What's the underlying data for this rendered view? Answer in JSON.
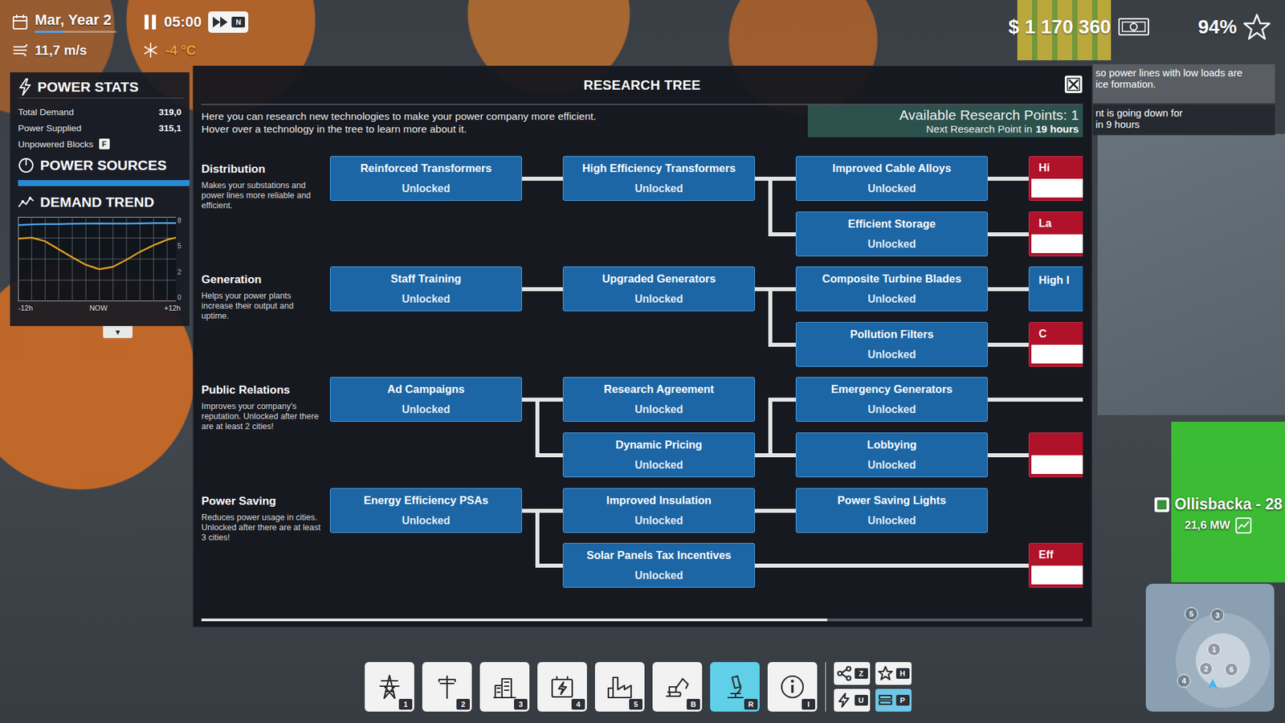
{
  "hud": {
    "date": "Mar, Year 2",
    "date_progress": {
      "level": 0.35
    },
    "time": "05:00",
    "fast_forward_key": "N",
    "wind": "11,7 m/s",
    "temperature": "-4 °C",
    "money": "$ 1 170 360",
    "rating": "94%"
  },
  "power_stats": {
    "title": "POWER STATS",
    "rows": [
      {
        "label": "Total Demand",
        "value": "319,0"
      },
      {
        "label": "Power Supplied",
        "value": "315,1"
      }
    ],
    "unpowered": {
      "label": "Unpowered Blocks",
      "key": "F"
    }
  },
  "power_sources": {
    "title": "POWER SOURCES",
    "level": 1.0
  },
  "demand_trend": {
    "title": "DEMAND TREND",
    "y_max": 800,
    "y_ticks": [
      "8",
      "5",
      "2",
      "0"
    ],
    "x_ticks": [
      "-12h",
      "NOW",
      "+12h"
    ],
    "series": [
      {
        "color": "#4aa8f0",
        "values": [
          745,
          752,
          755,
          755,
          758,
          760,
          762,
          760,
          760,
          762,
          765,
          765,
          766
        ]
      },
      {
        "color": "#e0a020",
        "values": [
          610,
          620,
          585,
          505,
          425,
          350,
          305,
          330,
          400,
          480,
          545,
          600,
          630
        ]
      }
    ]
  },
  "expand_button": "▼",
  "research": {
    "title": "RESEARCH TREE",
    "intro": [
      "Here you can research new technologies to make your power company more efficient.",
      "Hover over a technology in the tree to learn more about it."
    ],
    "points_label": "Available Research Points:",
    "points": "1",
    "next_prefix": "Next Research Point in",
    "next_time": "19 hours",
    "categories": [
      {
        "name": "Distribution",
        "description": "Makes your substations and power lines more reliable and efficient.",
        "columns": [
          [
            {
              "label": "Reinforced Transformers",
              "status": "Unlocked",
              "kind": "unlocked",
              "parent": ""
            }
          ],
          [
            {
              "label": "High Efficiency Transformers",
              "status": "Unlocked",
              "kind": "unlocked",
              "parent": "Reinforced Transformers"
            }
          ],
          [
            {
              "label": "Improved Cable Alloys",
              "status": "Unlocked",
              "kind": "unlocked",
              "parent": "High Efficiency Transformers"
            },
            {
              "label": "Efficient Storage",
              "status": "Unlocked",
              "kind": "unlocked",
              "parent": "High Efficiency Transformers"
            }
          ],
          [
            {
              "label": "Hi",
              "kind": "locked",
              "parent": "Improved Cable Alloys"
            },
            {
              "label": "La",
              "kind": "locked",
              "parent": "Efficient Storage"
            }
          ]
        ]
      },
      {
        "name": "Generation",
        "description": "Helps your power plants increase their output and uptime.",
        "columns": [
          [
            {
              "label": "Staff Training",
              "status": "Unlocked",
              "kind": "unlocked",
              "parent": ""
            }
          ],
          [
            {
              "label": "Upgraded Generators",
              "status": "Unlocked",
              "kind": "unlocked",
              "parent": "Staff Training"
            }
          ],
          [
            {
              "label": "Composite Turbine Blades",
              "status": "Unlocked",
              "kind": "unlocked",
              "parent": "Upgraded Generators"
            },
            {
              "label": "Pollution Filters",
              "status": "Unlocked",
              "kind": "unlocked",
              "parent": "Upgraded Generators"
            }
          ],
          [
            {
              "label": "High I",
              "kind": "unlocked",
              "parent": "Composite Turbine Blades"
            },
            {
              "label": "C",
              "kind": "locked",
              "parent": "Pollution Filters"
            }
          ]
        ]
      },
      {
        "name": "Public Relations",
        "description": "Improves your company's reputation. Unlocked after there are at least 2 cities!",
        "columns": [
          [
            {
              "label": "Ad Campaigns",
              "status": "Unlocked",
              "kind": "unlocked",
              "parent": ""
            }
          ],
          [
            {
              "label": "Research Agreement",
              "status": "Unlocked",
              "kind": "unlocked",
              "parent": "Ad Campaigns"
            },
            {
              "label": "Dynamic Pricing",
              "status": "Unlocked",
              "kind": "unlocked",
              "parent": "Ad Campaigns"
            }
          ],
          [
            {
              "label": "Emergency Generators",
              "status": "Unlocked",
              "kind": "unlocked",
              "parent": "Dynamic Pricing"
            },
            {
              "label": "Lobbying",
              "status": "Unlocked",
              "kind": "unlocked",
              "parent": "Dynamic Pricing"
            }
          ],
          [
            {
              "kind": "offscreen",
              "parent": "Emergency Generators"
            },
            {
              "kind": "locked",
              "parent": "Lobbying"
            }
          ]
        ]
      },
      {
        "name": "Power Saving",
        "description": "Reduces power usage in cities. Unlocked after there are at least 3 cities!",
        "columns": [
          [
            {
              "label": "Energy Efficiency PSAs",
              "status": "Unlocked",
              "kind": "unlocked",
              "parent": ""
            }
          ],
          [
            {
              "label": "Improved Insulation",
              "status": "Unlocked",
              "kind": "unlocked",
              "parent": "Energy Efficiency PSAs"
            },
            {
              "label": "Solar Panels Tax Incentives",
              "status": "Unlocked",
              "kind": "unlocked",
              "parent": "Energy Efficiency PSAs"
            }
          ],
          [
            {
              "label": "Power Saving Lights",
              "status": "Unlocked",
              "kind": "unlocked",
              "parent": "Improved Insulation"
            },
            null
          ],
          [
            null,
            {
              "label": "Eff",
              "kind": "locked",
              "parent": "Solar Panels Tax Incentives"
            }
          ]
        ]
      }
    ],
    "scrollbar": {
      "level": 0.71
    }
  },
  "notifications": [
    {
      "lines": [
        "so power lines with low loads are",
        "ice formation."
      ]
    },
    {
      "lines": [
        "nt is going down for",
        "in 9 hours"
      ]
    }
  ],
  "city": {
    "name": "Ollisbacka - 28",
    "power": "21,6 MW"
  },
  "toolbar": {
    "tools": [
      {
        "key": "1",
        "selected": false
      },
      {
        "key": "2",
        "selected": false
      },
      {
        "key": "3",
        "selected": false
      },
      {
        "key": "4",
        "selected": false
      },
      {
        "key": "5",
        "selected": false
      },
      {
        "key": "B",
        "selected": false
      },
      {
        "key": "R",
        "selected": true
      },
      {
        "key": "I",
        "selected": false
      }
    ],
    "shortcuts": [
      {
        "key": "Z",
        "selected": false
      },
      {
        "key": "H",
        "selected": false
      },
      {
        "key": "U",
        "selected": false
      },
      {
        "key": "P",
        "selected": true
      }
    ]
  },
  "minimap": {
    "pins": [
      "5",
      "3",
      "1",
      "2",
      "6",
      "4"
    ]
  }
}
